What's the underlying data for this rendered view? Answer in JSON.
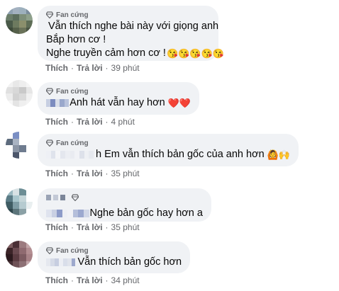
{
  "badge_label": "Fan cứng",
  "like_label": "Thích",
  "reply_label": "Trả lời",
  "separator": "·",
  "comments": [
    {
      "text_line1": "Vẫn thích nghe bài này với giọng anh",
      "text_line2": "Bắp hơn cơ !",
      "text_line3": "Nghe truyền cảm hơn cơ !",
      "emojis": "😘😘😘😘😘",
      "time": "39 phút"
    },
    {
      "text": "Anh hát vẫn hay hơn",
      "emojis": "❤️❤️",
      "time": "4 phút"
    },
    {
      "text": "h Em vẫn thích bản gốc của anh hơn",
      "emojis": "🙆🙌",
      "time": "35 phút"
    },
    {
      "text": "Nghe bản gốc hay hơn a",
      "time": "35 phút"
    },
    {
      "text": "Vẫn thích bản gốc hơn",
      "time": "34 phút"
    }
  ],
  "colors": {
    "bubble": "#f0f2f5",
    "meta_text": "#65676b",
    "text": "#050505"
  }
}
